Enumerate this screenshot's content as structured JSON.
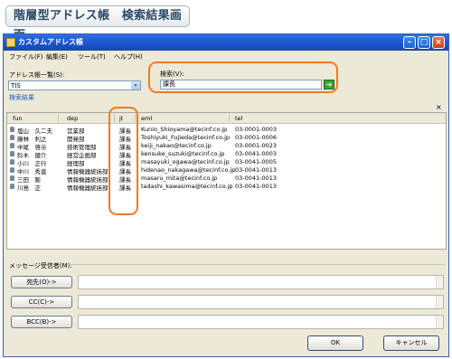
{
  "caption": "階層型アドレス帳　検索結果画面",
  "window": {
    "title": "カスタムアドレス帳",
    "minimize_glyph": "–",
    "maximize_glyph": "□",
    "close_glyph": "×"
  },
  "menu": [
    "ファイル(F)",
    "編集(E)",
    "ツール(T)",
    "ヘルプ(H)"
  ],
  "address_list": {
    "label": "アドレス帳一覧(S):",
    "selected": "TIS",
    "arrow": "▾"
  },
  "search": {
    "label": "検索(V):",
    "value": "課長",
    "go_glyph": "➔"
  },
  "results": {
    "label": "検索結果",
    "close_glyph": "×",
    "columns": [
      "fun",
      "dep",
      "jt",
      "eml",
      "tel"
    ],
    "rows": [
      {
        "fun": "塩山　久二夫",
        "dep": "営業部",
        "jt": "課長",
        "eml": "Kunio_Shioyama@tecinf.co.jp",
        "tel": "03-0001-0003"
      },
      {
        "fun": "藤林　利之",
        "dep": "開発部",
        "jt": "課長",
        "eml": "Toshiyuki_Fujieda@tecinf.co.jp",
        "tel": "03-0001-0006"
      },
      {
        "fun": "中尾　啓示",
        "dep": "技術管理部",
        "jt": "課長",
        "eml": "keiji_nakao@tecinf.co.jp",
        "tel": "03-0001-0023"
      },
      {
        "fun": "鈴木　健介",
        "dep": "経営企画部",
        "jt": "課長",
        "eml": "kensuke_suzuki@tecinf.co.jp",
        "tel": "03-0041-0003"
      },
      {
        "fun": "小川　正行",
        "dep": "経理部",
        "jt": "課長",
        "eml": "masayuki_ogawa@tecinf.co.jp",
        "tel": "03-0041-0005"
      },
      {
        "fun": "中川　秀直",
        "dep": "情報機器統括部",
        "jt": "課長",
        "eml": "hidenao_nakagawa@tecinf.co.jp",
        "tel": "03-0041-0013"
      },
      {
        "fun": "三田　膨",
        "dep": "情報機器統括部",
        "jt": "課長",
        "eml": "masaru_mita@tecinf.co.jp",
        "tel": "03-0041-0013"
      },
      {
        "fun": "川島　正",
        "dep": "情報機器統括部",
        "jt": "課長",
        "eml": "tadashi_kawasima@tecinf.co.jp",
        "tel": "03-0041-0013"
      }
    ]
  },
  "recipients": {
    "label": "メッセージ受信者(M):",
    "to_label": "宛先(O)->",
    "cc_label": "CC(C)->",
    "bcc_label": "BCC(B)->"
  },
  "buttons": {
    "ok": "OK",
    "cancel": "キャンセル"
  },
  "colors": {
    "highlight": "#f47a1e",
    "title_bar": "#1b52c9",
    "section_label": "#1f5fbf"
  }
}
